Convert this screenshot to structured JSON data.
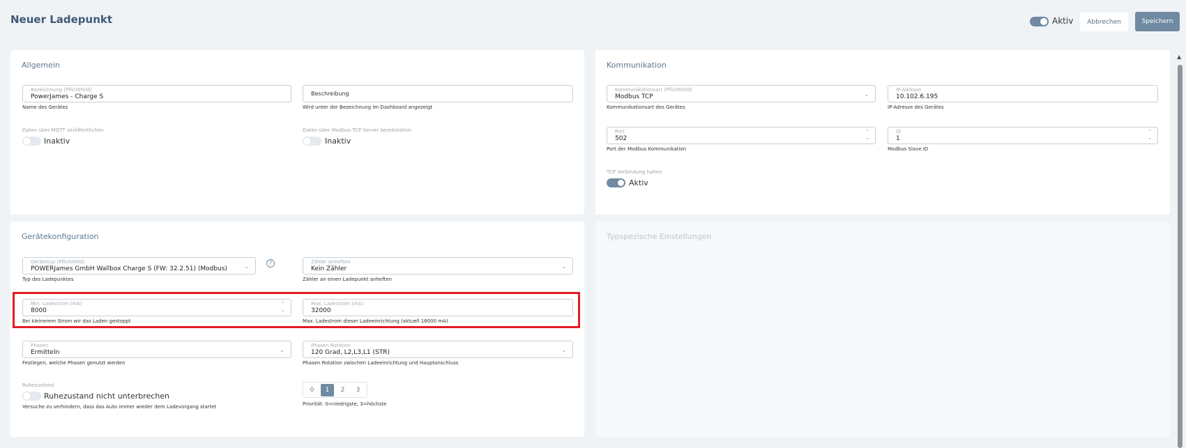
{
  "header": {
    "title": "Neuer Ladepunkt",
    "active_label": "Aktiv",
    "cancel_label": "Abbrechen",
    "save_label": "Speichern"
  },
  "general": {
    "title": "Allgemein",
    "name_label": "Bezeichnung (Pflichtfeld)",
    "name_value": "PowerJames - Charge S",
    "name_hint": "Name des Gerätes",
    "desc_placeholder": "Beschreibung",
    "desc_hint": "Wird unter der Bezeichnung im Dashboard angezeigt",
    "mqtt_label": "Daten über MQTT veröffentlichen",
    "mqtt_state": "Inaktiv",
    "modbus_label": "Daten über Modbus TCP Server bereitstellen",
    "modbus_state": "Inaktiv"
  },
  "communication": {
    "title": "Kommunikation",
    "type_label": "Kommunikationsart (Pflichtfeld)",
    "type_value": "Modbus TCP",
    "type_hint": "Kommunikationsart des Gerätes",
    "ip_label": "IP-Adresse",
    "ip_value": "10.102.6.195",
    "ip_hint": "IP-Adresse des Gerätes",
    "port_label": "Port",
    "port_value": "502",
    "port_hint": "Port der Modbus Kommunikation",
    "id_label": "ID",
    "id_value": "1",
    "id_hint": "Modbus Slave ID",
    "tcp_label": "TCP Verbindung halten",
    "tcp_state": "Aktiv"
  },
  "device": {
    "title": "Gerätekonfiguration",
    "type_label": "Gerätetyp (Pflichtfeld)",
    "type_value": "POWERJames GmbH Wallbox Charge S (FW: 32.2.51) (Modbus)",
    "type_hint": "Typ des Ladepunktes",
    "meter_label": "Zähler Anheften",
    "meter_value": "Kein Zähler",
    "meter_hint": "Zähler an einen Ladepunkt anheften",
    "min_label": "Min. Ladestrom (mA)",
    "min_value": "8000",
    "min_hint": "Bei kleinerem Strom wir das Laden gestoppt",
    "max_label": "Max. Ladestrom (mA)",
    "max_value": "32000",
    "max_hint": "Max. Ladestrom dieser Ladeeinrichtung (aktuell 16000 mA)",
    "phases_label": "Phasen",
    "phases_value": "Ermitteln",
    "phases_hint": "Festlegen, welche Phasen genutzt werden",
    "rotation_label": "Phasen Rotation",
    "rotation_value": "120 Grad, L2,L3,L1 (STR)",
    "rotation_hint": "Phasen Rotation zwischen Ladeeinrichtung und Hauptanschluss",
    "idle_label": "Ruhezustand",
    "idle_state": "Ruhezustand nicht unterbrechen",
    "idle_hint": "Versuche zu verhindern, dass das Auto immer wieder dem Ladevorgang startet",
    "priority_options": [
      "0",
      "1",
      "2",
      "3"
    ],
    "priority_selected": "1",
    "priority_hint": "Priorität: 0=niedrigste, 3=höchste",
    "help_glyph": "?"
  },
  "type_settings": {
    "title": "Typspezische Einstellungen"
  },
  "glyphs": {
    "chevron": "⌄",
    "spin": "⌃\n⌄",
    "scroll_up": "▲"
  }
}
